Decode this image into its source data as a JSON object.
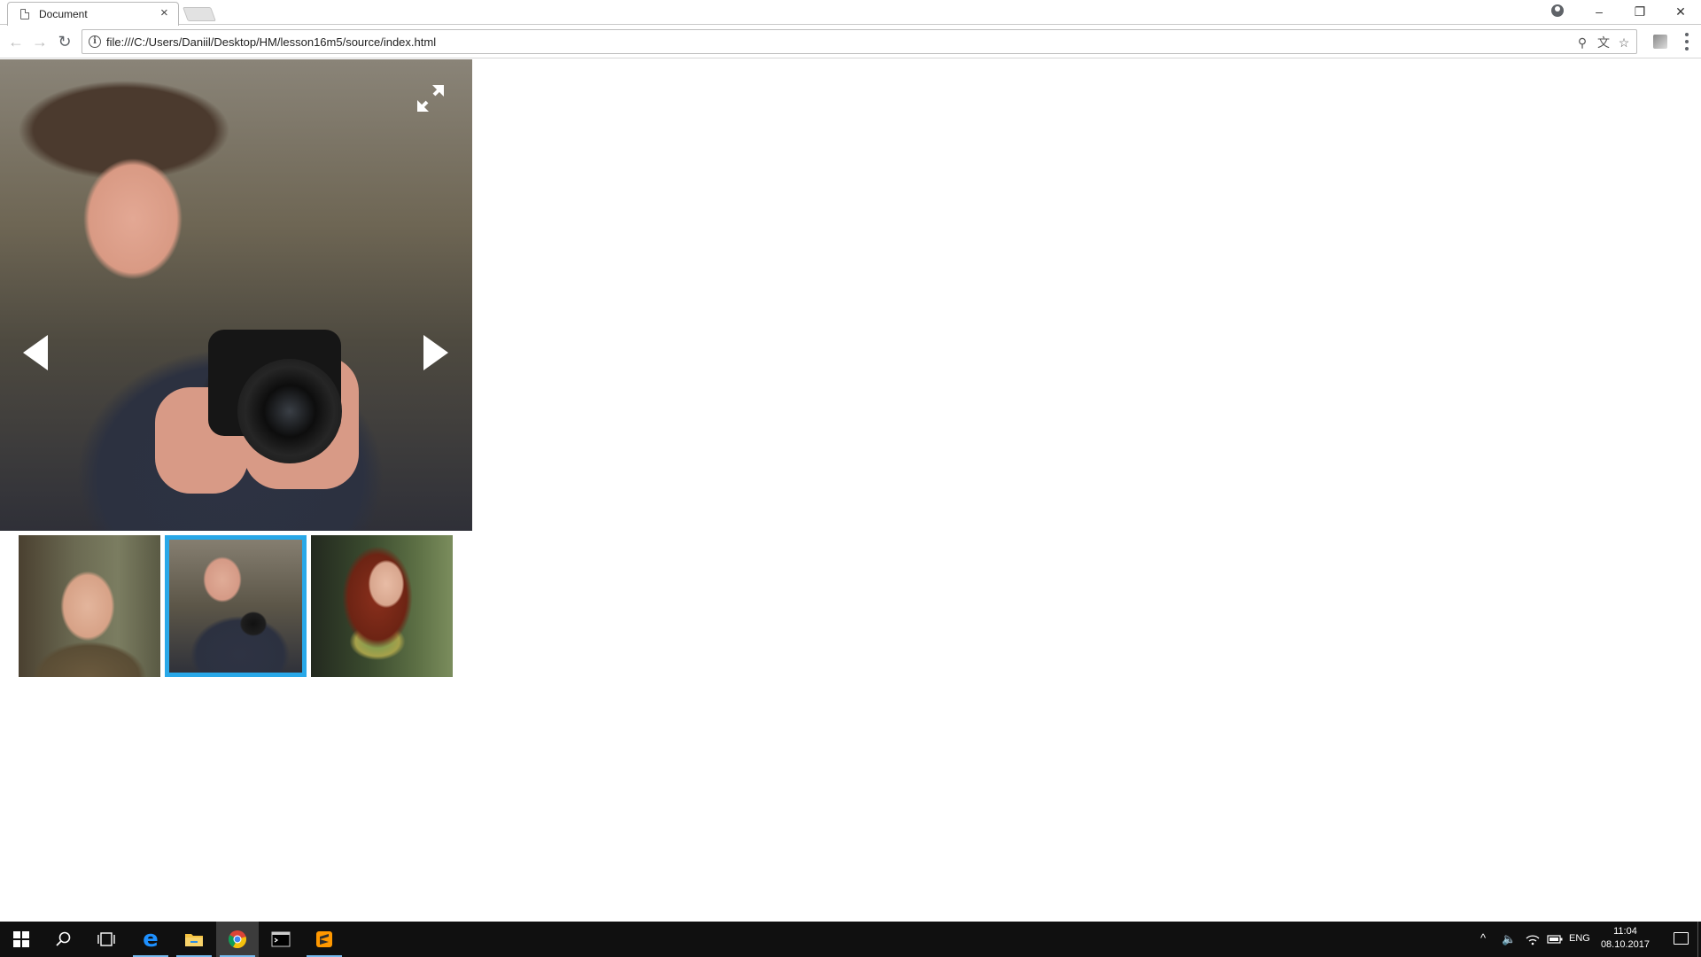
{
  "browser": {
    "tab": {
      "title": "Document",
      "close_glyph": "×"
    },
    "window_controls": {
      "minimize": "–",
      "restore": "❐",
      "close": "✕"
    },
    "toolbar": {
      "back_glyph": "←",
      "forward_glyph": "→",
      "reload_glyph": "↻",
      "info_glyph": "i",
      "url": "file:///C:/Users/Daniil/Desktop/HM/lesson16m5/source/index.html",
      "zoom_glyph": "⚲",
      "translate_glyph": "文",
      "bookmark_glyph": "☆"
    }
  },
  "gallery": {
    "main_image": {
      "subject": "young man holding a camera"
    },
    "prev_icon": "arrow-left-icon",
    "next_icon": "arrow-right-icon",
    "fullscreen_icon": "fullscreen-icon",
    "active_index": 1,
    "thumbnails": [
      {
        "subject": "older bald man smiling"
      },
      {
        "subject": "young man holding a camera"
      },
      {
        "subject": "woman with red hair and scarf"
      }
    ],
    "colors": {
      "active_border": "#29a8e8"
    }
  },
  "taskbar": {
    "language": "ENG",
    "time": "11:04",
    "date": "08.10.2017",
    "colors": {
      "background": "#101010",
      "active_indicator": "#76b9ed"
    }
  }
}
